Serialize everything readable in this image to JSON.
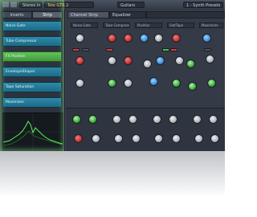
{
  "topbar": {
    "preset": "Stereo In",
    "track": "Tele GTR 2",
    "instrument": "Guitars",
    "extra": "1 - Synth Presets"
  },
  "left_panel": {
    "tabs": [
      "Inserts",
      "Strip"
    ],
    "active_tab": "Strip",
    "slots": [
      "Noise Gate",
      "Tube Compressor",
      "FX Position",
      "EnvelopeShaper",
      "Tape Saturation",
      "Maximizer"
    ],
    "selected_slot": "FX Position"
  },
  "right_panel": {
    "tabs": [
      "Channel Strip",
      "Equalizer"
    ],
    "active_tab": "Channel Strip",
    "modules": [
      "Noise Gate",
      "Tube Compressor",
      "Position",
      "Sat/Tape",
      "Maximizer"
    ]
  },
  "colors": {
    "accent_green": "#63c35a",
    "slot_blue": "#2c8aa8",
    "knob_red": "#c23232",
    "knob_blue": "#3c8fd8",
    "knob_green": "#3fae3c"
  }
}
